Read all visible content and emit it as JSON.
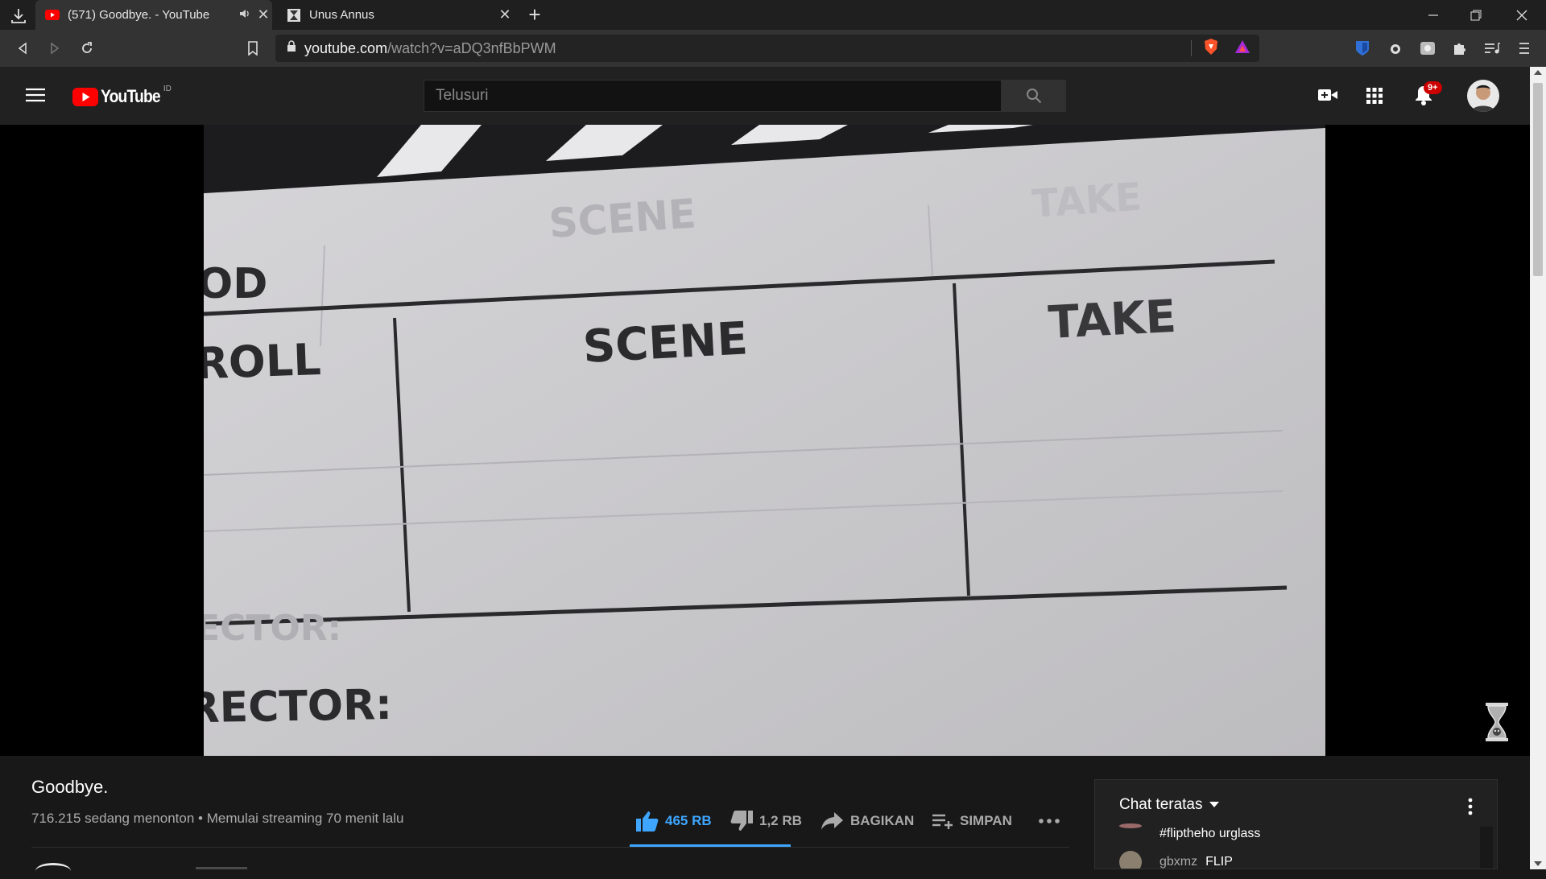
{
  "browser": {
    "tabs": [
      {
        "title": "(571) Goodbye. - YouTube",
        "active": true,
        "audio": true
      },
      {
        "title": "Unus Annus",
        "active": false
      }
    ],
    "url_host": "youtube.com",
    "url_path": "/watch?v=aDQ3nfBbPWM"
  },
  "youtube": {
    "logo_text": "YouTube",
    "country_code": "ID",
    "search_placeholder": "Telusuri",
    "notification_badge": "9+"
  },
  "video": {
    "frame_text": {
      "scene": "SCENE",
      "take": "TAKE",
      "roll": "ROLL",
      "prod": "OD",
      "director": "RECTOR:"
    }
  },
  "info": {
    "title": "Goodbye.",
    "views": "716.215 sedang menonton",
    "separator": "•",
    "started": "Memulai streaming 70 menit lalu",
    "like_count": "465 RB",
    "dislike_count": "1,2 RB",
    "share_label": "BAGIKAN",
    "save_label": "SIMPAN"
  },
  "chat": {
    "header": "Chat teratas",
    "messages": [
      {
        "author": "",
        "text": "#fliptheho urglass"
      },
      {
        "author": "gbxmz",
        "text": "FLIP"
      }
    ]
  },
  "colors": {
    "yt_red": "#ff0000",
    "like_blue": "#3ea6ff",
    "badge_red": "#cc0000"
  }
}
